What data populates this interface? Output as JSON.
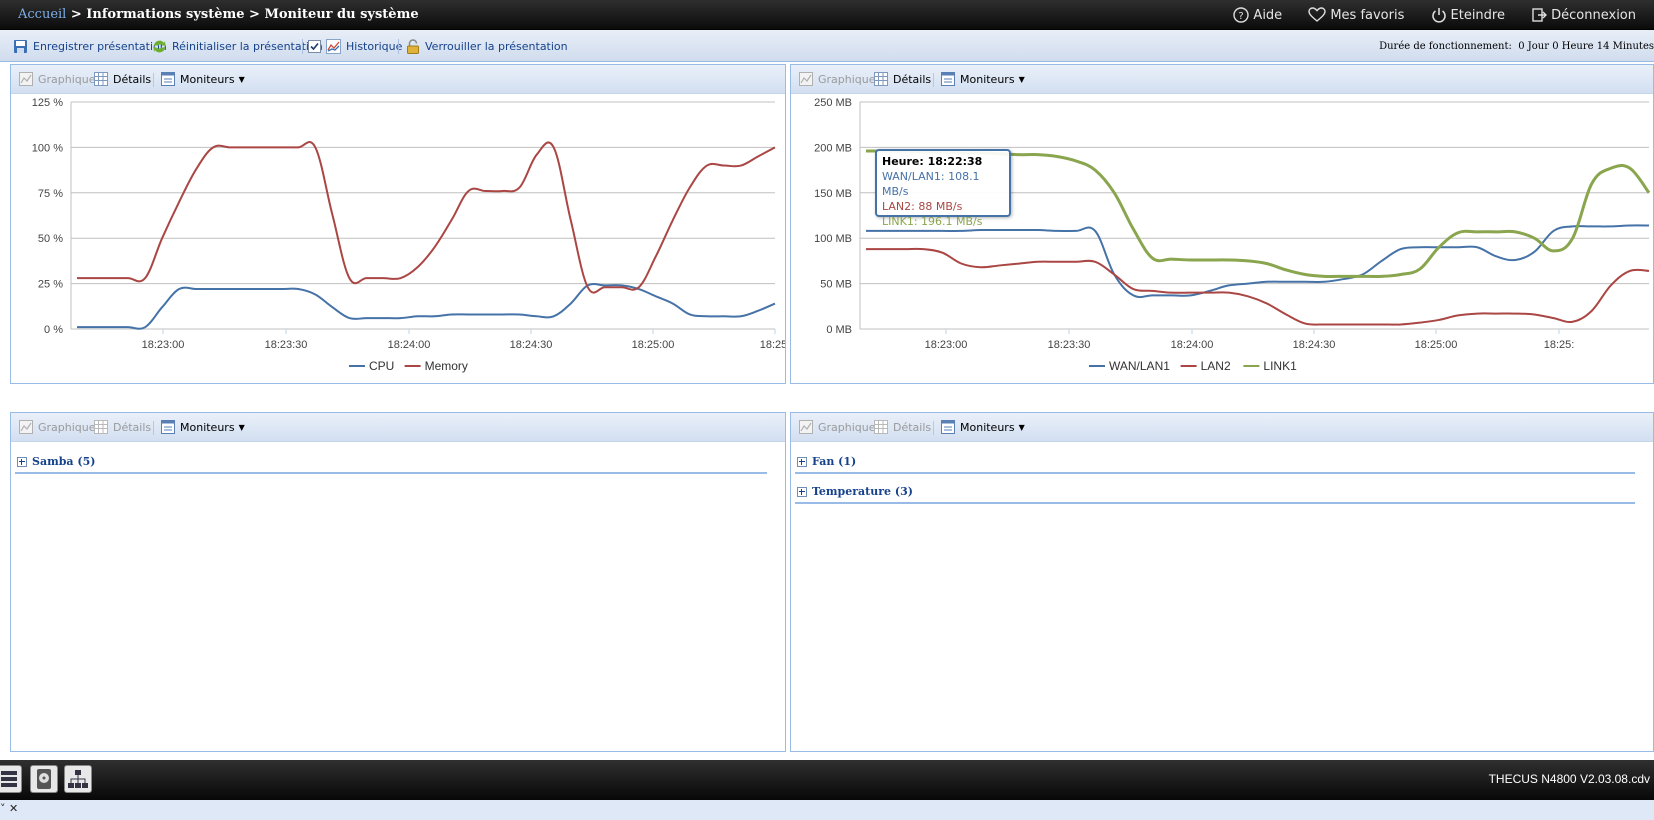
{
  "breadcrumb": {
    "home": "Accueil",
    "sep1": " > ",
    "section": "Informations système",
    "sep2": " > ",
    "page": "Moniteur du système"
  },
  "topnav": {
    "help": "Aide",
    "favorites": "Mes favoris",
    "shutdown": "Eteindre",
    "logout": "Déconnexion"
  },
  "toolbar": {
    "save": "Enregistrer présentation",
    "reset": "Réinitialiser la présentation",
    "history": "Historique",
    "history_checked": true,
    "lock": "Verrouiller la présentation",
    "uptime_label": "Durée de fonctionnement:",
    "uptime_value": "0 Jour 0 Heure 14 Minutes"
  },
  "panel_toolbar": {
    "graph": "Graphique",
    "details": "Détails",
    "monitors": "Moniteurs"
  },
  "groups": {
    "samba": "Samba (5)",
    "fan": "Fan (1)",
    "temperature": "Temperature (3)"
  },
  "tooltip": {
    "time": "Heure: 18:22:38",
    "wan": "WAN/LAN1: 108.1 MB/s",
    "lan2": "LAN2: 88 MB/s",
    "link1": "LINK1: 196.1 MB/s"
  },
  "footer": {
    "version": "THECUS N4800 V2.03.08.cdv",
    "status_left": "˅ ✕"
  },
  "colors": {
    "blue": "#4572a7",
    "red": "#aa4643",
    "green": "#89a54e"
  },
  "chart_data": [
    {
      "type": "line",
      "ylabel_ticks": [
        "0 %",
        "25 %",
        "50 %",
        "75 %",
        "100 %",
        "125 %"
      ],
      "ylim": [
        0,
        125
      ],
      "x": [
        "18:22:30",
        "18:22:35",
        "18:22:40",
        "18:22:45",
        "18:22:50",
        "18:22:55",
        "18:23:00",
        "18:23:05",
        "18:23:10",
        "18:23:15",
        "18:23:20",
        "18:23:25",
        "18:23:30",
        "18:23:35",
        "18:23:40",
        "18:23:45",
        "18:23:50",
        "18:23:55",
        "18:24:00",
        "18:24:05",
        "18:24:10",
        "18:24:15",
        "18:24:20",
        "18:24:25",
        "18:24:30",
        "18:24:35",
        "18:24:40",
        "18:24:45",
        "18:24:50",
        "18:24:55",
        "18:25:00",
        "18:25:05",
        "18:25:10",
        "18:25:15",
        "18:25:20",
        "18:25:25"
      ],
      "x_ticks": [
        "18:23:00",
        "18:23:30",
        "18:24:00",
        "18:24:30",
        "18:25:00",
        "18:25:"
      ],
      "series": [
        {
          "name": "CPU",
          "color": "#4572a7",
          "values": [
            1,
            1,
            1,
            1,
            1,
            12,
            22,
            22,
            22,
            22,
            22,
            22,
            22,
            22,
            19,
            12,
            6,
            6,
            6,
            6,
            7,
            7,
            8,
            8,
            8,
            8,
            8,
            7,
            7,
            14,
            24,
            24,
            24,
            22,
            18,
            14,
            8,
            7,
            7,
            7,
            10,
            14
          ]
        },
        {
          "name": "Memory",
          "color": "#aa4643",
          "values": [
            28,
            28,
            28,
            28,
            28,
            50,
            70,
            88,
            100,
            100,
            100,
            100,
            100,
            100,
            100,
            63,
            28,
            28,
            28,
            28,
            34,
            45,
            60,
            76,
            76,
            76,
            78,
            96,
            100,
            60,
            23,
            23,
            23,
            23,
            40,
            60,
            78,
            90,
            90,
            90,
            95,
            100
          ]
        }
      ]
    },
    {
      "type": "line",
      "ylabel_ticks": [
        "0 MB",
        "50 MB",
        "100 MB",
        "150 MB",
        "200 MB",
        "250 MB"
      ],
      "ylim": [
        0,
        250
      ],
      "x_ticks": [
        "18:23:00",
        "18:23:30",
        "18:24:00",
        "18:24:30",
        "18:25:00",
        "18:25:"
      ],
      "series": [
        {
          "name": "WAN/LAN1",
          "color": "#4572a7",
          "values": [
            108,
            108,
            108,
            108,
            108,
            108,
            109,
            109,
            109,
            109,
            108,
            108,
            108,
            60,
            37,
            37,
            37,
            37,
            42,
            48,
            50,
            52,
            52,
            52,
            52,
            55,
            60,
            75,
            88,
            90,
            90,
            90,
            90,
            80,
            76,
            85,
            108,
            113,
            113,
            113,
            114,
            114
          ]
        },
        {
          "name": "LAN2",
          "color": "#aa4643",
          "values": [
            88,
            88,
            88,
            88,
            84,
            72,
            68,
            70,
            72,
            74,
            74,
            74,
            74,
            60,
            44,
            42,
            40,
            40,
            40,
            40,
            36,
            28,
            16,
            6,
            5,
            5,
            5,
            5,
            5,
            7,
            10,
            15,
            17,
            17,
            17,
            16,
            12,
            8,
            20,
            48,
            64,
            64
          ]
        },
        {
          "name": "LINK1",
          "color": "#89a54e",
          "values": [
            196,
            196,
            196,
            195,
            195,
            194,
            194,
            193,
            192,
            192,
            190,
            185,
            175,
            150,
            110,
            78,
            77,
            76,
            76,
            76,
            75,
            72,
            65,
            60,
            58,
            58,
            58,
            58,
            60,
            66,
            90,
            106,
            107,
            107,
            107,
            100,
            86,
            100,
            160,
            177,
            177,
            150
          ]
        }
      ]
    }
  ]
}
